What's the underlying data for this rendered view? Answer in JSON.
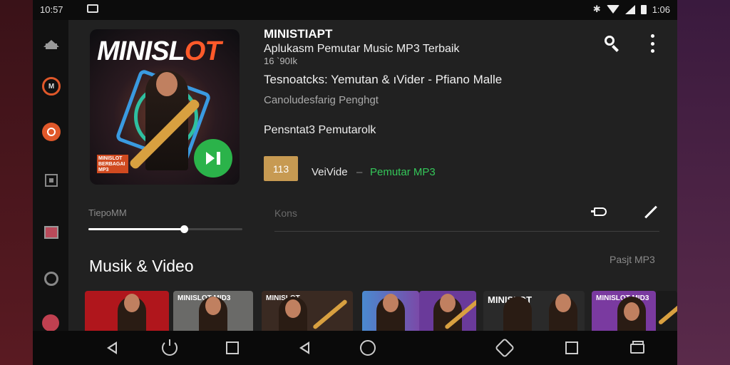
{
  "status_bar": {
    "time": "10:57",
    "bluetooth": "✱",
    "battery_text": "1:06"
  },
  "header": {
    "app_title": "MINISTIAPT",
    "subtitle": "Aplukasm Pemutar Music MP3 Terbaik",
    "meta": "16 `90Ik",
    "track_line": "Tesnoatcks: Yemutan & ıVider - Pfiano Malle",
    "description": "Canoludesfarig Penghgt",
    "secondary": "Pensntat3 Pemutarolk"
  },
  "cover": {
    "title_white": "MINISL",
    "title_orange": "OT",
    "badge_text": "MINISLOT BERBAGAI MP3"
  },
  "badge": {
    "value": "113"
  },
  "video_line": {
    "label": "VeiVide",
    "separator": "–",
    "link": "Pemutar MP3"
  },
  "player": {
    "time_label": "TiepoMM",
    "progress_fraction": 0.62,
    "second_label": "Kons"
  },
  "section": {
    "title": "Musik & Video",
    "link": "Pasjt MP3"
  },
  "thumbnails": [
    {
      "label": "",
      "bg": "#b0161c"
    },
    {
      "label": "MINISLOT MID3",
      "bg": "#6a6a68"
    },
    {
      "label": "MINISLOT",
      "bg": "#3a2a22"
    },
    {
      "label": "",
      "bg": "#4a8ad0"
    },
    {
      "label": "",
      "bg": "#6a3a9a"
    },
    {
      "label": "MINISLOT",
      "bg": "#2a2a2a"
    },
    {
      "label": "MINISLOT MID3",
      "bg": "#7a3aa0"
    },
    {
      "label": "",
      "bg": "#1a1a1a"
    }
  ],
  "colors": {
    "accent_green": "#34c759",
    "play_green": "#2bb34a",
    "badge_gold": "#c79a52",
    "brand_orange": "#ff5a2a"
  },
  "icons": {
    "rail": [
      "home-icon",
      "ring-icon",
      "record-icon",
      "square-icon",
      "image-icon",
      "settings-icon",
      "avatar-icon"
    ],
    "nav": [
      "back-icon",
      "power-icon",
      "recents-icon",
      "back-icon",
      "home-icon",
      "rotate-icon",
      "recents-icon",
      "window-icon"
    ]
  }
}
